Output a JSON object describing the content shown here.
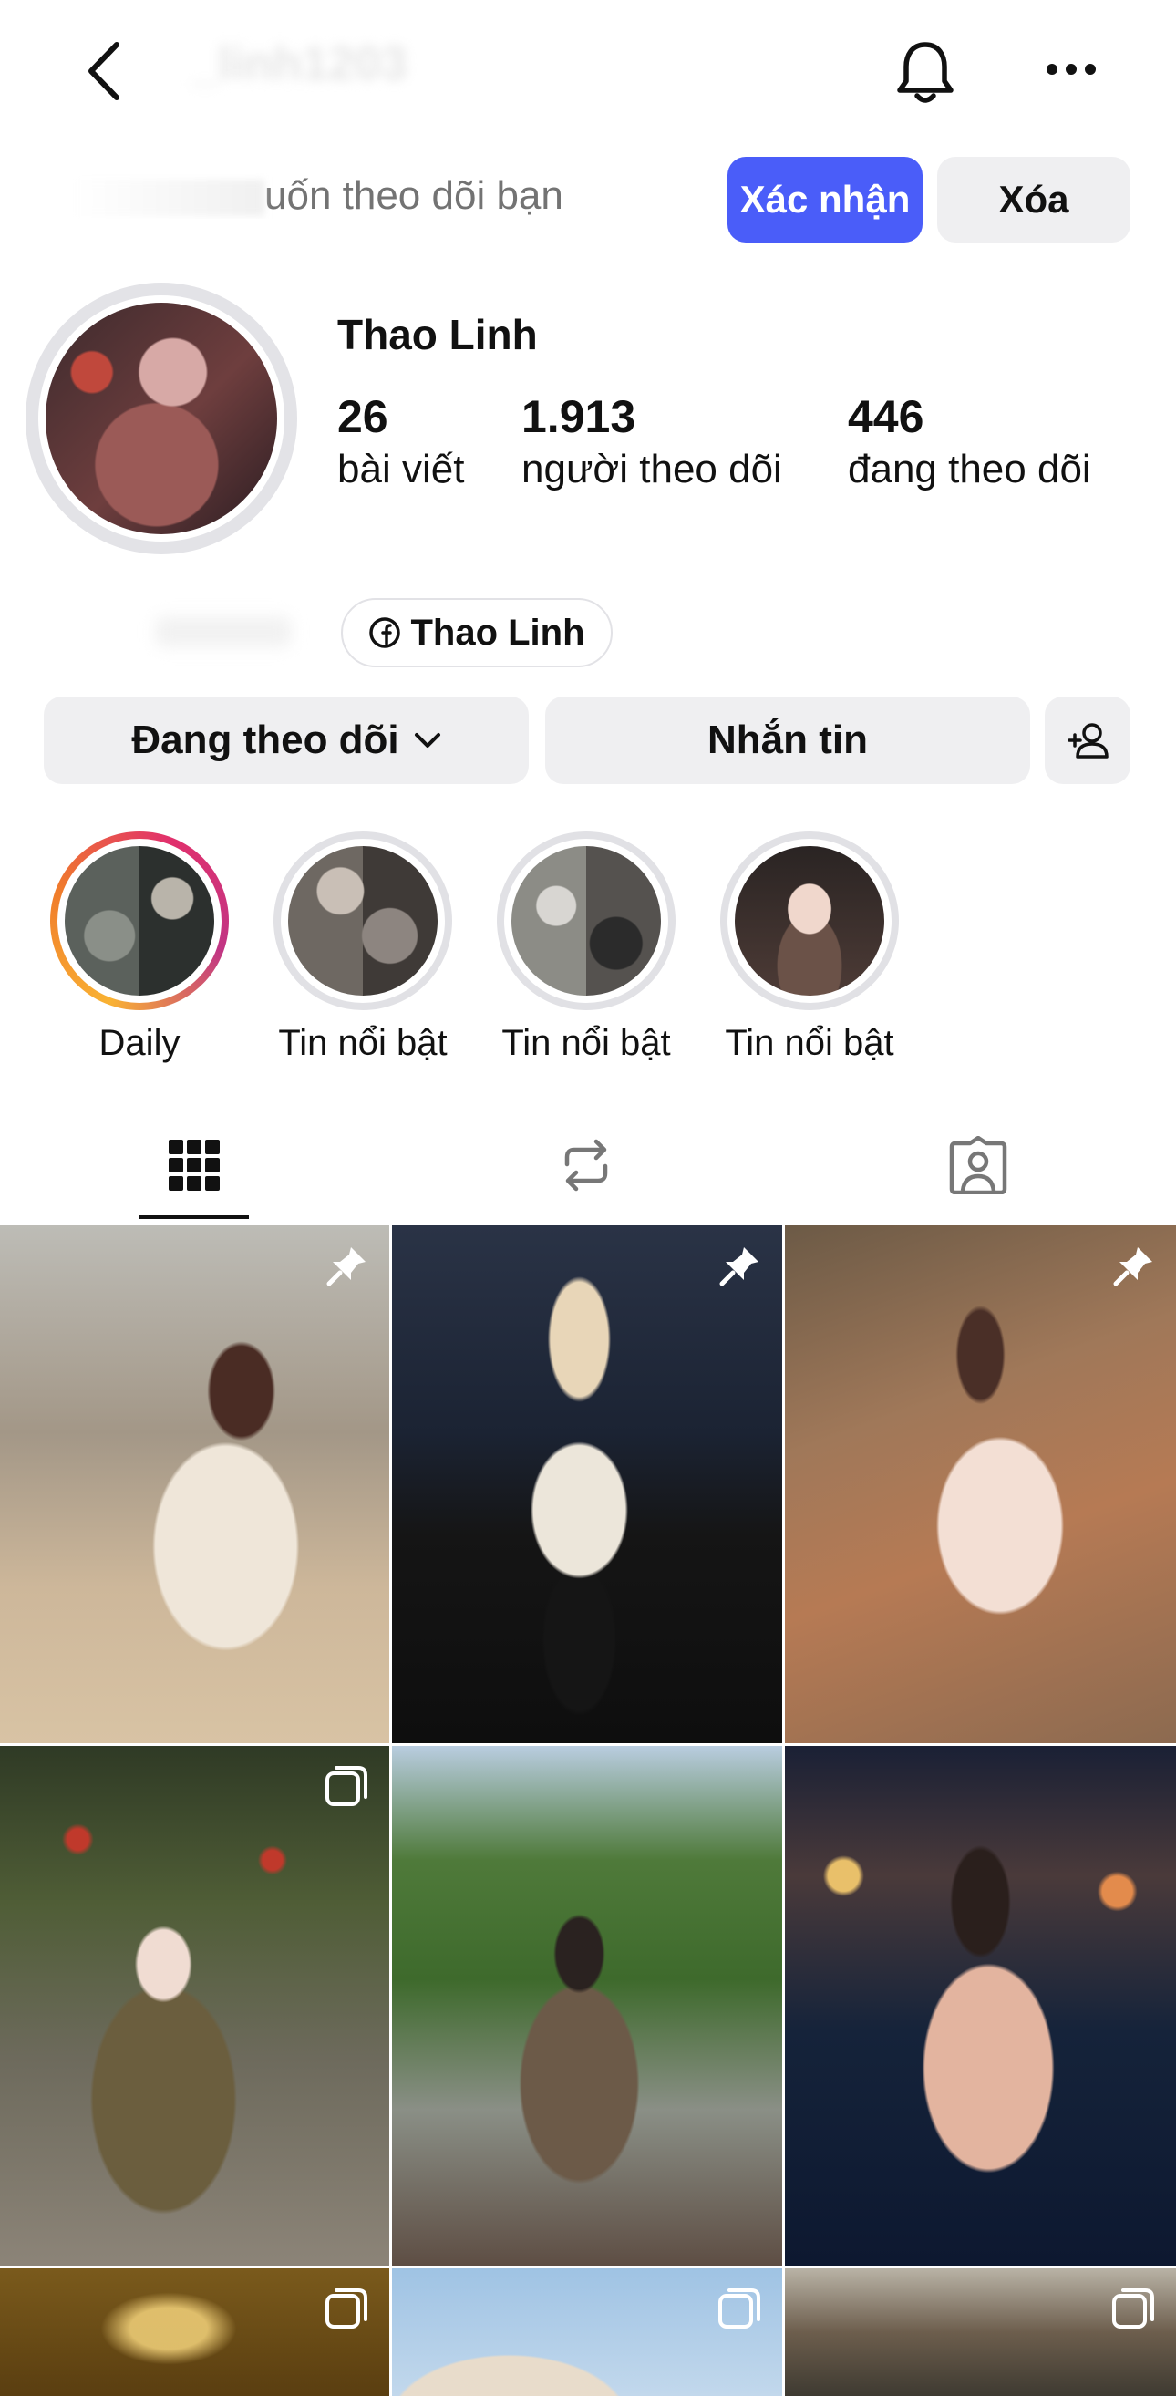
{
  "nav": {
    "username": "_linh1203",
    "icons": [
      "back-arrow-icon",
      "bell-icon",
      "more-icon"
    ]
  },
  "follow_request": {
    "text": "uốn theo dõi bạn",
    "confirm_label": "Xác nhận",
    "delete_label": "Xóa"
  },
  "profile": {
    "name": "Thao Linh",
    "stats": [
      {
        "value": "26",
        "label": "bài viết"
      },
      {
        "value": "1.913",
        "label": "người theo dõi"
      },
      {
        "value": "446",
        "label": "đang theo dõi"
      }
    ],
    "facebook_link": "Thao Linh"
  },
  "actions": {
    "following_label": "Đang theo dõi",
    "message_label": "Nhắn tin"
  },
  "highlights": [
    {
      "label": "Daily"
    },
    {
      "label": "Tin nổi bật"
    },
    {
      "label": "Tin nổi bật"
    },
    {
      "label": "Tin nổi bật"
    }
  ],
  "tabs": [
    "grid-tab",
    "reposts-tab",
    "tagged-tab"
  ],
  "colors": {
    "accent": "#4a5df9",
    "button_grey": "#efeff1",
    "text": "#111111",
    "muted": "#737373"
  }
}
